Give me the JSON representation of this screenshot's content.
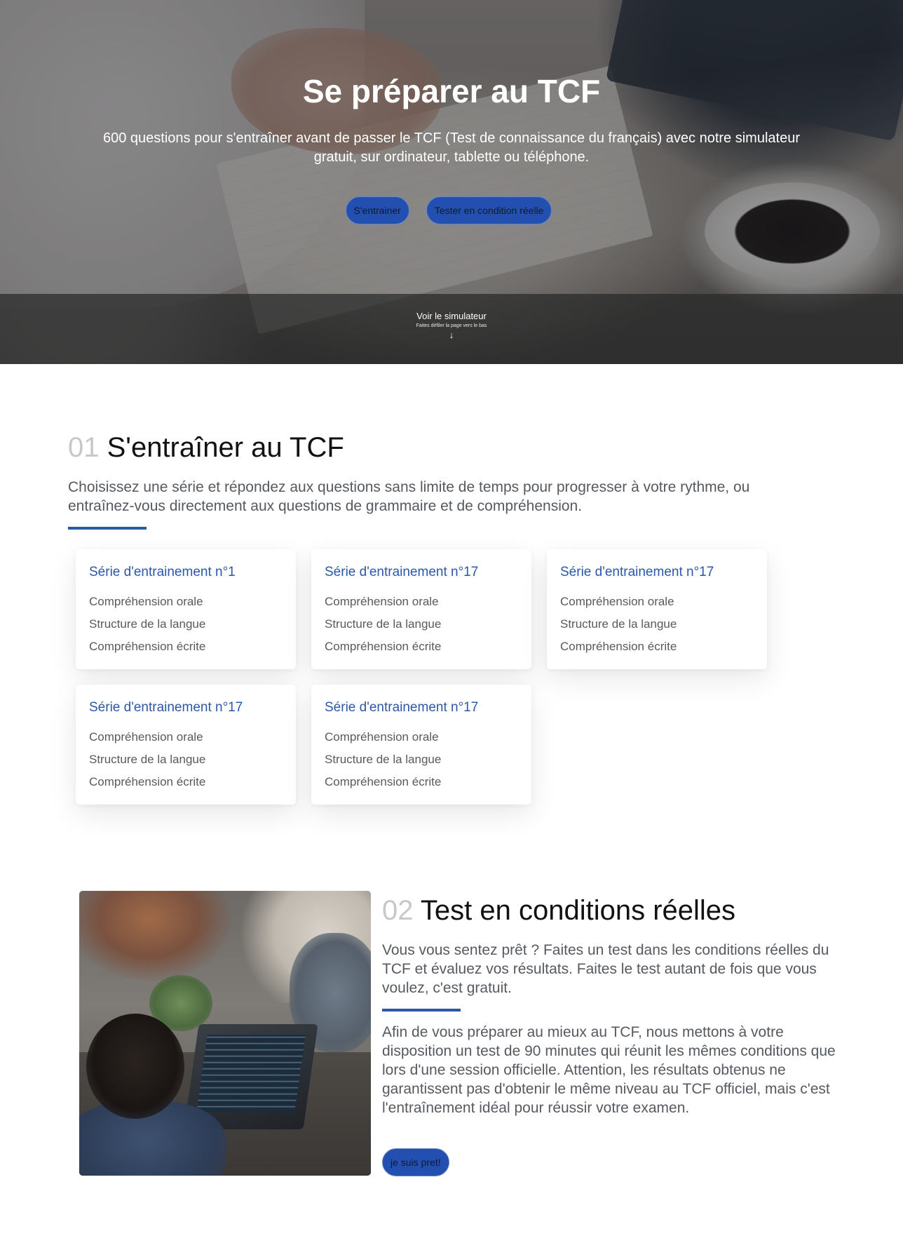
{
  "hero": {
    "title": "Se préparer au TCF",
    "subtitle": "600 questions pour s'entraîner avant de passer le TCF (Test de connaissance du français) avec notre simulateur gratuit, sur ordinateur, tablette ou téléphone.",
    "buttons": {
      "train": "S'entrainer",
      "real_test": "Tester en condition réelle"
    },
    "band": {
      "title": "Voir le simulateur",
      "hint": "Faites défiler la page vers le bas",
      "arrow_icon": "arrow-down-icon"
    }
  },
  "section1": {
    "number": "01",
    "title": "S'entraîner au TCF",
    "description": "Choisissez une série et répondez aux questions sans limite de temps pour progresser à votre rythme, ou entraînez-vous directement aux questions de grammaire et de compréhension.",
    "cards": [
      {
        "title": "Série d'entrainement n°1",
        "items": [
          "Compréhension orale",
          "Structure de la langue",
          "Compréhension écrite"
        ]
      },
      {
        "title": "Série d'entrainement n°17",
        "items": [
          "Compréhension orale",
          "Structure de la langue",
          "Compréhension écrite"
        ]
      },
      {
        "title": "Série d'entrainement n°17",
        "items": [
          "Compréhension orale",
          "Structure de la langue",
          "Compréhension écrite"
        ]
      },
      {
        "title": "Série d'entrainement n°17",
        "items": [
          "Compréhension orale",
          "Structure de la langue",
          "Compréhension écrite"
        ]
      },
      {
        "title": "Série d'entrainement n°17",
        "items": [
          "Compréhension orale",
          "Structure de la langue",
          "Compréhension écrite"
        ]
      }
    ]
  },
  "section2": {
    "number": "02",
    "title": "Test en conditions réelles",
    "description": "Vous vous sentez prêt ? Faites un test dans les conditions réelles du TCF et évaluez vos résultats. Faites le test autant de fois que vous voulez, c'est gratuit.",
    "body": "Afin de vous préparer au mieux au TCF, nous mettons à votre disposition un test de 90 minutes qui réunit les mêmes conditions que lors d'une session officielle. Attention, les résultats obtenus ne garantissent pas d'obtenir le même niveau au TCF officiel, mais c'est l'entraînement idéal pour réussir votre examen.",
    "button": "je suis pret!"
  },
  "colors": {
    "accent": "#2b58a8",
    "button_bg": "#2350b0",
    "number_gray": "#c8c8c8",
    "text_gray": "#555a60"
  }
}
